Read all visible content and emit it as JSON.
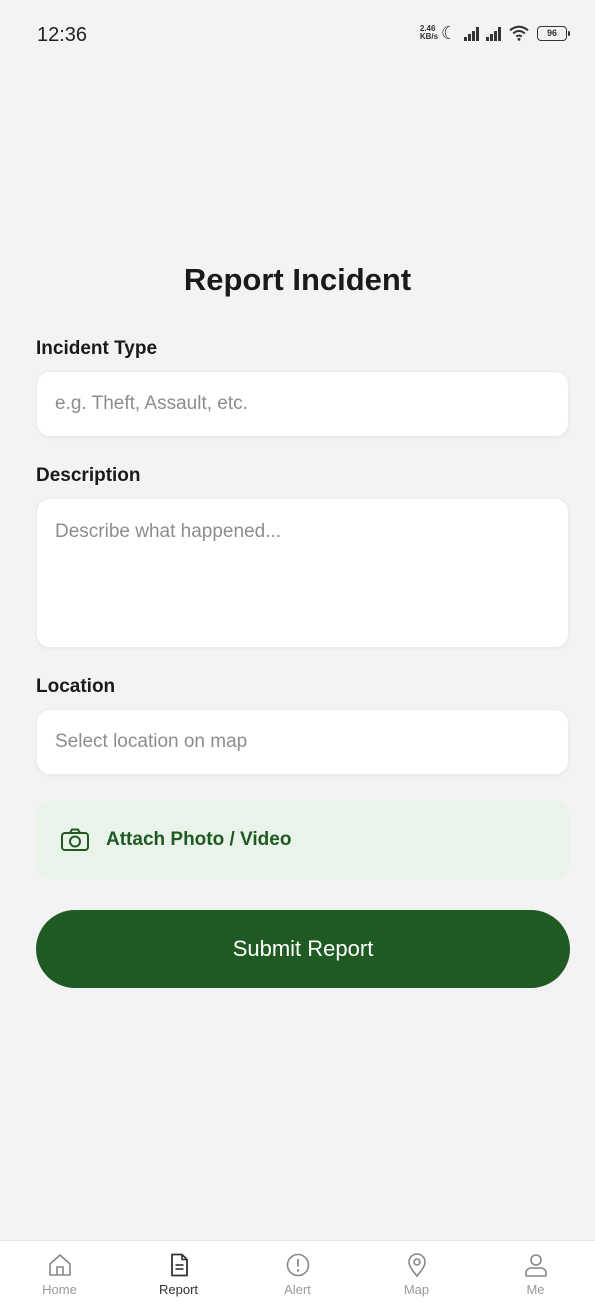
{
  "status_bar": {
    "time": "12:36",
    "net_speed_top": "2.46",
    "net_speed_bottom": "KB/s",
    "battery": "96"
  },
  "page": {
    "title": "Report Incident"
  },
  "form": {
    "incident_type": {
      "label": "Incident Type",
      "placeholder": "e.g. Theft, Assault, etc.",
      "value": ""
    },
    "description": {
      "label": "Description",
      "placeholder": "Describe what happened...",
      "value": ""
    },
    "location": {
      "label": "Location",
      "placeholder": "Select location on map",
      "value": ""
    },
    "attach": {
      "label": "Attach Photo / Video",
      "icon": "camera-icon"
    },
    "submit": {
      "label": "Submit Report"
    }
  },
  "bottom_nav": {
    "items": [
      {
        "label": "Home",
        "icon": "home-icon",
        "active": false
      },
      {
        "label": "Report",
        "icon": "document-icon",
        "active": true
      },
      {
        "label": "Alert",
        "icon": "alert-icon",
        "active": false
      },
      {
        "label": "Map",
        "icon": "map-pin-icon",
        "active": false
      },
      {
        "label": "Me",
        "icon": "user-icon",
        "active": false
      }
    ]
  },
  "colors": {
    "primary": "#1e5a22",
    "attach_background": "#e9f3e9",
    "background": "#f3f3f3"
  }
}
